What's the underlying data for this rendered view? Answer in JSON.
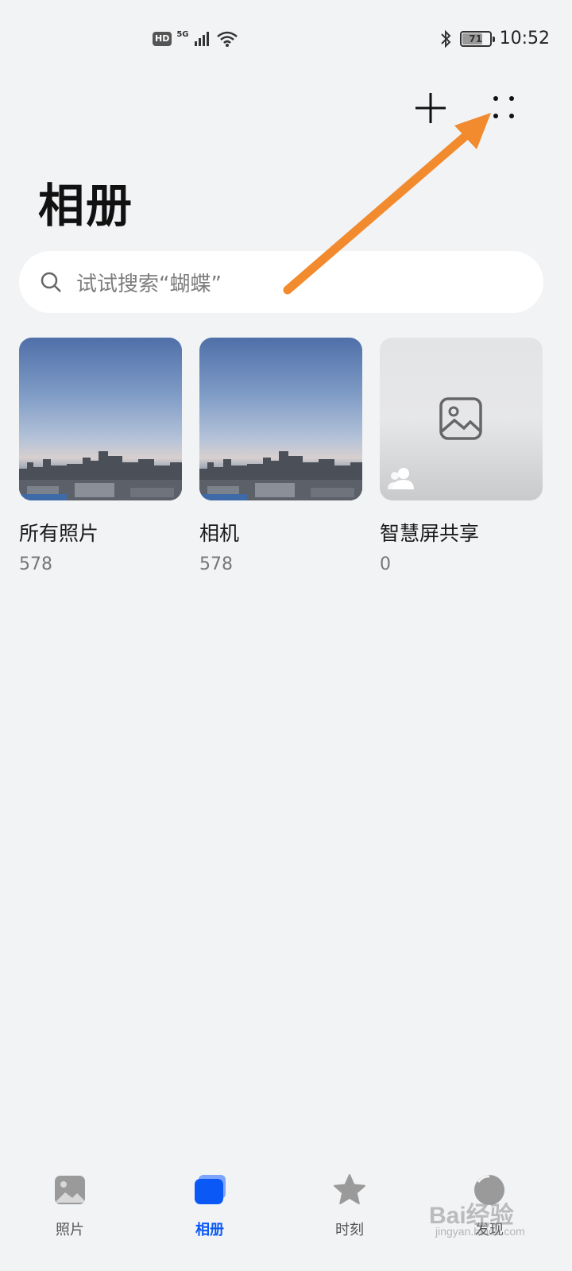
{
  "status_bar": {
    "hd": "HD",
    "network": "5G",
    "battery_level": "71",
    "time": "10:52"
  },
  "header": {
    "title": "相册"
  },
  "search": {
    "placeholder": "试试搜索“蝴蝶”"
  },
  "albums": [
    {
      "name": "所有照片",
      "count": "578",
      "icon": "landscape-thumbnail"
    },
    {
      "name": "相机",
      "count": "578",
      "icon": "landscape-thumbnail"
    },
    {
      "name": "智慧屏共享",
      "count": "0",
      "icon": "image-placeholder-icon"
    }
  ],
  "bottom_nav": {
    "items": [
      {
        "label": "照片",
        "icon": "photo-icon",
        "active": false
      },
      {
        "label": "相册",
        "icon": "album-icon",
        "active": true
      },
      {
        "label": "时刻",
        "icon": "star-icon",
        "active": false
      },
      {
        "label": "发现",
        "icon": "discover-icon",
        "active": false
      }
    ]
  },
  "colors": {
    "background": "#f1f3f5",
    "accent": "#0a59f7",
    "annotation_arrow": "#f28a2e"
  },
  "watermark": {
    "brand": "Bai经验",
    "url": "jingyan.baidu.com"
  }
}
